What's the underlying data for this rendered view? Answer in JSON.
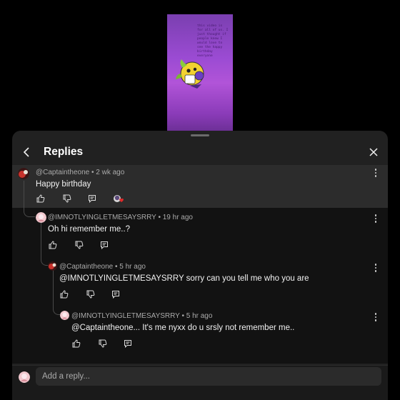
{
  "video": {
    "thumbnail_text": "this video is for all of us. I just thought if people knew I would love to see the happy birthday everyone"
  },
  "sheet": {
    "title": "Replies"
  },
  "comments": [
    {
      "author": "@Captaintheone",
      "time": "2 wk ago",
      "text": "Happy birthday"
    },
    {
      "author": "@IMNOTLYINGLETMESAYSRRY",
      "time": "19 hr ago",
      "text": "Oh hi remember me..?"
    },
    {
      "author": "@Captaintheone",
      "time": "5 hr ago",
      "text": "@IMNOTLYINGLETMESAYSRRY sorry can you tell me who you are"
    },
    {
      "author": "@IMNOTLYINGLETMESAYSRRY",
      "time": "5 hr ago",
      "text": "@Captaintheone... It's me nyxx do u srsly not remember me.."
    }
  ],
  "footer": {
    "reply_placeholder": "Add a reply..."
  },
  "colors": {
    "sheet_bg": "#212121",
    "highlight_bg": "#2c2c2c",
    "reply_bg": "#121212",
    "text_primary": "#f1f1f1",
    "text_secondary": "#aaaaaa",
    "thumbnail_purple": "#9b4bd3"
  },
  "icons": [
    "back-arrow-icon",
    "close-icon",
    "like-icon",
    "dislike-icon",
    "reply-icon",
    "heart-icon",
    "more-options-icon"
  ]
}
